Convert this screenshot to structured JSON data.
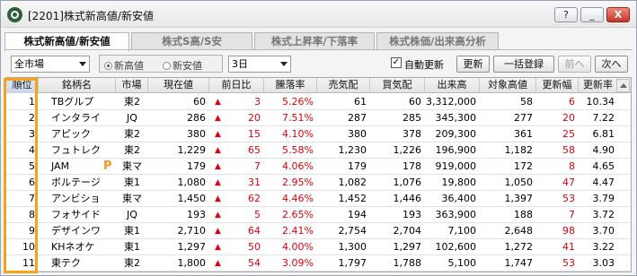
{
  "window": {
    "title": "[2201]株式新高値/新安値",
    "buttons": {
      "help": "?",
      "minimize": "_",
      "close": "X"
    }
  },
  "tabs": [
    {
      "label": "株式新高値/新安値",
      "active": true
    },
    {
      "label": "株式S高/S安",
      "active": false
    },
    {
      "label": "株式上昇率/下落率",
      "active": false
    },
    {
      "label": "株式株価/出来高分析",
      "active": false
    }
  ],
  "toolbar": {
    "market_select": "全市場",
    "radio_high": "新高値",
    "radio_low": "新安値",
    "period_select": "3日",
    "auto_update_label": "自動更新",
    "auto_update_checked": true,
    "update_button": "更新",
    "register_button": "一括登録",
    "prev_button": "前へ",
    "next_button": "次へ"
  },
  "table": {
    "columns": [
      "順位",
      "銘柄名",
      "市場",
      "現在値",
      "前日比",
      "騰落率",
      "売気配",
      "買気配",
      "出来高",
      "対象高値",
      "更新幅",
      "更新率"
    ],
    "rows": [
      {
        "rank": "1",
        "name": "TBグルプ",
        "market": "東2",
        "price": "60",
        "change": "3",
        "rate": "5.26%",
        "ask": "61",
        "bid": "60",
        "volume": "3,312,000",
        "target": "58",
        "width": "6",
        "update_rate": "10.34"
      },
      {
        "rank": "2",
        "name": "インタライ",
        "market": "JQ",
        "price": "286",
        "change": "20",
        "rate": "7.51%",
        "ask": "287",
        "bid": "285",
        "volume": "345,300",
        "target": "277",
        "width": "20",
        "update_rate": "7.22"
      },
      {
        "rank": "3",
        "name": "アピック",
        "market": "東2",
        "price": "380",
        "change": "15",
        "rate": "4.10%",
        "ask": "380",
        "bid": "378",
        "volume": "209,300",
        "target": "361",
        "width": "25",
        "update_rate": "6.81"
      },
      {
        "rank": "4",
        "name": "フュトレク",
        "market": "東2",
        "price": "1,229",
        "change": "65",
        "rate": "5.58%",
        "ask": "1,230",
        "bid": "1,226",
        "volume": "196,900",
        "target": "1,182",
        "width": "58",
        "update_rate": "4.90"
      },
      {
        "rank": "5",
        "name": "JAM",
        "market": "東マ",
        "price": "179",
        "change": "7",
        "rate": "4.06%",
        "ask": "179",
        "bid": "178",
        "volume": "919,000",
        "target": "172",
        "width": "8",
        "update_rate": "4.65",
        "mark": "P"
      },
      {
        "rank": "6",
        "name": "ボルテージ",
        "market": "東1",
        "price": "1,080",
        "change": "31",
        "rate": "2.95%",
        "ask": "1,082",
        "bid": "1,076",
        "volume": "19,800",
        "target": "1,050",
        "width": "47",
        "update_rate": "4.47"
      },
      {
        "rank": "7",
        "name": "アンビショ",
        "market": "東マ",
        "price": "1,450",
        "change": "62",
        "rate": "4.46%",
        "ask": "1,452",
        "bid": "1,446",
        "volume": "36,400",
        "target": "1,397",
        "width": "53",
        "update_rate": "3.79"
      },
      {
        "rank": "8",
        "name": "フォサイド",
        "market": "JQ",
        "price": "193",
        "change": "5",
        "rate": "2.65%",
        "ask": "194",
        "bid": "193",
        "volume": "363,900",
        "target": "188",
        "width": "7",
        "update_rate": "3.72"
      },
      {
        "rank": "9",
        "name": "デザインワ",
        "market": "東1",
        "price": "2,710",
        "change": "64",
        "rate": "2.41%",
        "ask": "2,754",
        "bid": "2,704",
        "volume": "7,100",
        "target": "2,648",
        "width": "98",
        "update_rate": "3.70"
      },
      {
        "rank": "10",
        "name": "KHネオケ",
        "market": "東1",
        "price": "1,297",
        "change": "50",
        "rate": "4.00%",
        "ask": "1,300",
        "bid": "1,297",
        "volume": "102,600",
        "target": "1,272",
        "width": "41",
        "update_rate": "3.22"
      },
      {
        "rank": "11",
        "name": "東テク",
        "market": "東2",
        "price": "1,800",
        "change": "54",
        "rate": "3.09%",
        "ask": "1,797",
        "bid": "1,788",
        "volume": "5,100",
        "target": "1,747",
        "width": "53",
        "update_rate": "3.03"
      }
    ]
  },
  "colors": {
    "accent_outline": "#f6a21a",
    "positive": "#e0000a",
    "p_mark": "#f09a1e"
  }
}
